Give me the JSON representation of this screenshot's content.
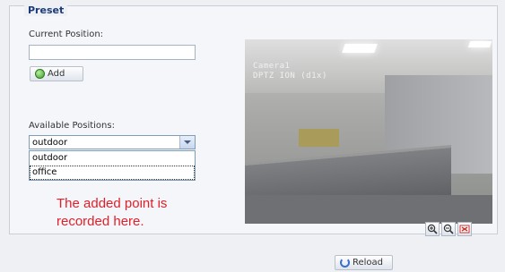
{
  "preset": {
    "legend": "Preset",
    "current_position_label": "Current Position:",
    "current_position_value": "",
    "add_label": "Add",
    "available_positions_label": "Available Positions:",
    "selected_position": "outdoor",
    "options": [
      "outdoor",
      "office"
    ]
  },
  "annotation": {
    "line1": "The added point is",
    "line2": "recorded here."
  },
  "video": {
    "overlay_line1": "Camera1",
    "overlay_line2": "DPTZ ION (d1x)"
  },
  "ptz": {
    "zoom_in_icon": "zoom-in-icon",
    "zoom_out_icon": "zoom-out-icon",
    "delete_icon": "delete-preset-icon"
  },
  "footer": {
    "reload_label": "Reload"
  },
  "colors": {
    "annotation": "#e0202a",
    "legend": "#1a3a7a"
  }
}
